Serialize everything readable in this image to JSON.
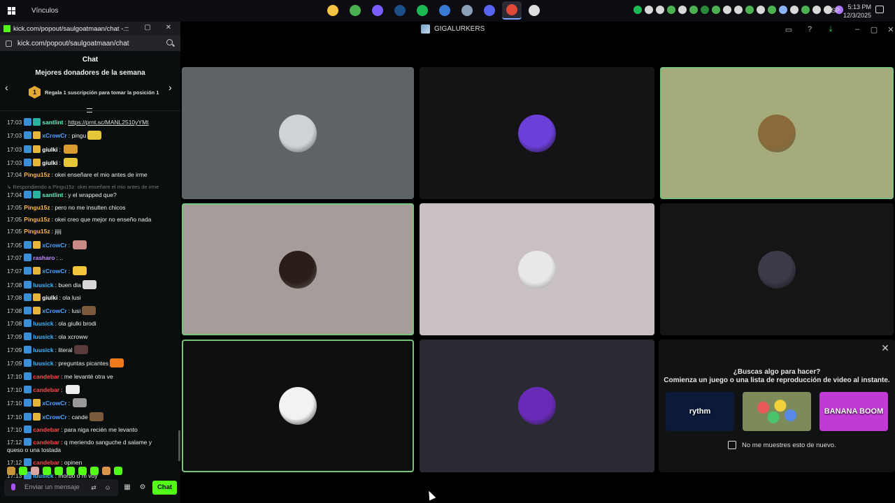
{
  "taskbar": {
    "start_label": "Vínculos",
    "language": "ESP",
    "time": "5:13 PM",
    "date": "12/3/2025",
    "apps": [
      {
        "name": "file-explorer",
        "color": "#f4c542"
      },
      {
        "name": "chrome",
        "color": "#4caf50"
      },
      {
        "name": "copilot",
        "color": "#7a5cff"
      },
      {
        "name": "steam",
        "color": "#1b4f8a"
      },
      {
        "name": "spotify",
        "color": "#1db954"
      },
      {
        "name": "store",
        "color": "#3a7bd5"
      },
      {
        "name": "files",
        "color": "#8aa0b8"
      },
      {
        "name": "discord",
        "color": "#5865f2"
      },
      {
        "name": "chrome-active",
        "color": "#e04a3a"
      },
      {
        "name": "chatgpt",
        "color": "#dddddd"
      }
    ]
  },
  "app": {
    "title": "GIGALURKERS",
    "tiles": [
      {
        "bg": "#5e6466",
        "avatar": "#cfd3d5",
        "speaking": false
      },
      {
        "bg": "#141416",
        "avatar": "#6b3fd8",
        "speaking": false
      },
      {
        "bg": "#a5ab7a",
        "avatar": "#8a6a3a",
        "speaking": true
      },
      {
        "bg": "#a69d9b",
        "avatar": "#2a1e18",
        "speaking": true
      },
      {
        "bg": "#c8c0c4",
        "avatar": "#e8e8e8",
        "speaking": false
      },
      {
        "bg": "#151516",
        "avatar": "#3a3a48",
        "speaking": false
      },
      {
        "bg": "#0f0f10",
        "avatar": "#f2f2f2",
        "speaking": true
      },
      {
        "bg": "#2a2a33",
        "avatar": "#6a2ab8",
        "speaking": false
      }
    ],
    "suggest": {
      "title": "¿Buscas algo para hacer?",
      "subtitle": "Comienza un juego o una lista de reproducción de video al instante.",
      "cards": [
        {
          "label": "rythm",
          "bg": "#0b1a3a"
        },
        {
          "label": "",
          "bg": "#7d8a5a"
        },
        {
          "label": "BANANA BOOM",
          "bg": "#c23ad6"
        }
      ],
      "checkbox_label": "No me muestres esto de nuevo."
    }
  },
  "popout": {
    "title": "kick.com/popout/saulgoatmaan/chat -...",
    "url": "kick.com/popout/saulgoatmaan/chat",
    "chat_heading": "Chat",
    "donors_title": "Mejores donadores de la semana",
    "donor_rank": "1",
    "donor_text": "Regala 1 suscripción para tomar la posición 1",
    "input_placeholder": "Enviar un mensaje",
    "chat_button": "Chat",
    "messages": [
      {
        "time": "17:03",
        "badges": [
          "b-blue",
          "b-teal"
        ],
        "user": "santlint",
        "color": "#65f0c4",
        "text": "",
        "link": "https://prnt.sc/MANL2510yYMt",
        "emote": ""
      },
      {
        "time": "17:03",
        "badges": [
          "b-blue",
          "b-crown"
        ],
        "user": "xCrowCr",
        "color": "#4fa3ff",
        "text": "pingu",
        "link": "",
        "emote": "#e8c63a"
      },
      {
        "time": "17:03",
        "badges": [
          "b-blue",
          "b-crown"
        ],
        "user": "giulki",
        "color": "#ffffff",
        "text": "",
        "link": "",
        "emote": "#d99a2e"
      },
      {
        "time": "17:03",
        "badges": [
          "b-blue",
          "b-crown"
        ],
        "user": "giulki",
        "color": "#ffffff",
        "text": "",
        "link": "",
        "emote": "#e8c63a"
      },
      {
        "time": "17:04",
        "badges": [],
        "user": "Pingu15z",
        "color": "#ffb84a",
        "text": "okei enseñare el mio antes de irme",
        "link": "",
        "emote": ""
      },
      {
        "time": "",
        "badges": [],
        "user": "",
        "color": "#777777",
        "text": "↳ Respondiendo a Pingu15z: okei enseñare el mio antes de irme",
        "link": "",
        "emote": "",
        "reply": true
      },
      {
        "time": "17:04",
        "badges": [
          "b-blue",
          "b-teal"
        ],
        "user": "santlint",
        "color": "#65f0c4",
        "text": "y el wrapped que?",
        "link": "",
        "emote": ""
      },
      {
        "time": "17:05",
        "badges": [],
        "user": "Pingu15z",
        "color": "#ffb84a",
        "text": "pero no me insulten chicos",
        "link": "",
        "emote": ""
      },
      {
        "time": "17:05",
        "badges": [],
        "user": "Pingu15z",
        "color": "#ffb84a",
        "text": "okei creo que mejor no enseño nada",
        "link": "",
        "emote": ""
      },
      {
        "time": "17:05",
        "badges": [],
        "user": "Pingu15z",
        "color": "#ffb84a",
        "text": "jijij",
        "link": "",
        "emote": ""
      },
      {
        "time": "17:05",
        "badges": [
          "b-blue",
          "b-crown"
        ],
        "user": "xCrowCr",
        "color": "#4fa3ff",
        "text": "",
        "link": "",
        "emote": "#c98a86"
      },
      {
        "time": "17:07",
        "badges": [
          "b-blue"
        ],
        "user": "rasharo",
        "color": "#c58bff",
        "text": "..",
        "link": "",
        "emote": ""
      },
      {
        "time": "17:07",
        "badges": [
          "b-blue",
          "b-crown"
        ],
        "user": "xCrowCr",
        "color": "#4fa3ff",
        "text": "",
        "link": "",
        "emote": "#f2c53a"
      },
      {
        "time": "17:08",
        "badges": [
          "b-blue"
        ],
        "user": "luusick",
        "color": "#3fb6ff",
        "text": "buen dia",
        "link": "",
        "emote": "#d8d8d8"
      },
      {
        "time": "17:08",
        "badges": [
          "b-blue",
          "b-crown"
        ],
        "user": "giulki",
        "color": "#ffffff",
        "text": "ola lusi",
        "link": "",
        "emote": ""
      },
      {
        "time": "17:08",
        "badges": [
          "b-blue",
          "b-crown"
        ],
        "user": "xCrowCr",
        "color": "#4fa3ff",
        "text": "lusi",
        "link": "",
        "emote": "#7a5a3a"
      },
      {
        "time": "17:08",
        "badges": [
          "b-blue"
        ],
        "user": "luusick",
        "color": "#3fb6ff",
        "text": "ola giulki brodi",
        "link": "",
        "emote": ""
      },
      {
        "time": "17:09",
        "badges": [
          "b-blue"
        ],
        "user": "luusick",
        "color": "#3fb6ff",
        "text": "ola xcroww",
        "link": "",
        "emote": ""
      },
      {
        "time": "17:09",
        "badges": [
          "b-blue"
        ],
        "user": "luusick",
        "color": "#3fb6ff",
        "text": "literal",
        "link": "",
        "emote": "#5a3a3a"
      },
      {
        "time": "17:09",
        "badges": [
          "b-blue"
        ],
        "user": "luusick",
        "color": "#3fb6ff",
        "text": "preguntas picantes",
        "link": "",
        "emote": "#f07a1a"
      },
      {
        "time": "17:10",
        "badges": [
          "b-blue"
        ],
        "user": "candebar",
        "color": "#ff4a4a",
        "text": "me levanté otra ve",
        "link": "",
        "emote": ""
      },
      {
        "time": "17:10",
        "badges": [
          "b-blue"
        ],
        "user": "candebar",
        "color": "#ff4a4a",
        "text": "",
        "link": "",
        "emote": "#eeeeee"
      },
      {
        "time": "17:10",
        "badges": [
          "b-blue",
          "b-crown"
        ],
        "user": "xCrowCr",
        "color": "#4fa3ff",
        "text": "",
        "link": "",
        "emote": "#999999"
      },
      {
        "time": "17:10",
        "badges": [
          "b-blue",
          "b-crown"
        ],
        "user": "xCrowCr",
        "color": "#4fa3ff",
        "text": "cande",
        "link": "",
        "emote": "#7a5a3a"
      },
      {
        "time": "17:10",
        "badges": [
          "b-blue"
        ],
        "user": "candebar",
        "color": "#ff4a4a",
        "text": "para niga recién me levanto",
        "link": "",
        "emote": ""
      },
      {
        "time": "17:12",
        "badges": [
          "b-blue"
        ],
        "user": "candebar",
        "color": "#ff4a4a",
        "text": "q meriendo sanguche d salame y queso o una tostada",
        "link": "",
        "emote": "",
        "wrap": true
      },
      {
        "time": "17:12",
        "badges": [
          "b-blue"
        ],
        "user": "candebar",
        "color": "#ff4a4a",
        "text": "opinen",
        "link": "",
        "emote": ""
      },
      {
        "time": "17:13",
        "badges": [
          "b-blue"
        ],
        "user": "luusick",
        "color": "#3fb6ff",
        "text": "morbo o m voy",
        "link": "",
        "emote": ""
      }
    ],
    "emote_bar": [
      "#c8963a",
      "#53fc18",
      "#d8a8a0",
      "#53fc18",
      "#53fc18",
      "#53fc18",
      "#53fc18",
      "#53fc18",
      "#d8944a",
      "#53fc18"
    ]
  }
}
